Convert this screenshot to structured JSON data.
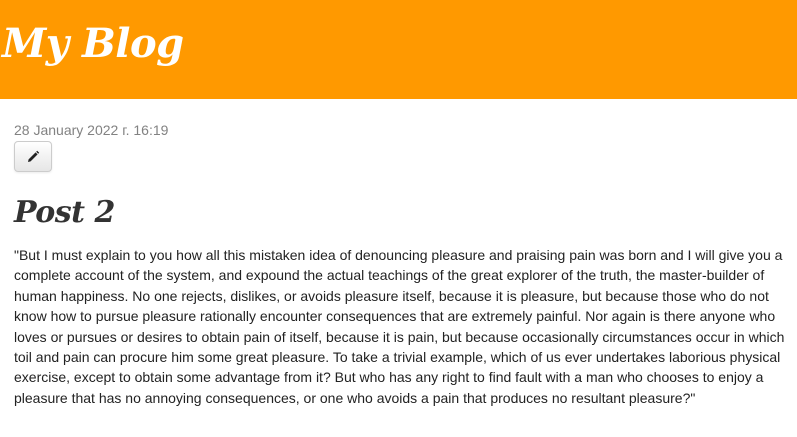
{
  "header": {
    "site_title": "My Blog",
    "background_color": "#ff9900"
  },
  "post": {
    "date": "28 January 2022 г. 16:19",
    "edit_button_icon": "pencil-icon",
    "title": "Post 2",
    "text": "\"But I must explain to you how all this mistaken idea of denouncing pleasure and praising pain was born and I will give you a complete account of the system, and expound the actual teachings of the great explorer of the truth, the master-builder of human happiness. No one rejects, dislikes, or avoids pleasure itself, because it is pleasure, but because those who do not know how to pursue pleasure rationally encounter consequences that are extremely painful. Nor again is there anyone who loves or pursues or desires to obtain pain of itself, because it is pain, but because occasionally circumstances occur in which toil and pain can procure him some great pleasure. To take a trivial example, which of us ever undertakes laborious physical exercise, except to obtain some advantage from it? But who has any right to find fault with a man who chooses to enjoy a pleasure that has no annoying consequences, or one who avoids a pain that produces no resultant pleasure?\""
  }
}
